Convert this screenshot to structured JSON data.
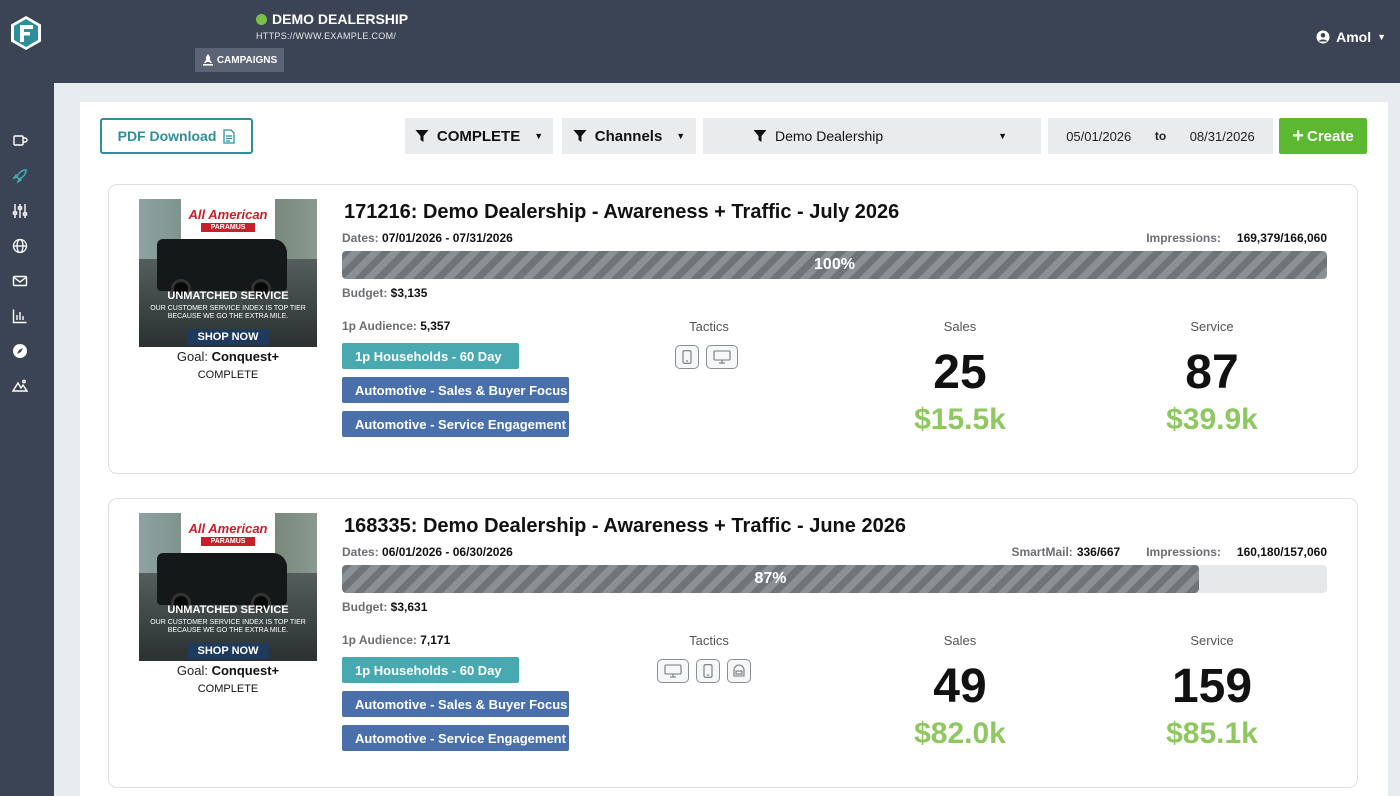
{
  "header": {
    "dealer_name": "DEMO DEALERSHIP",
    "dealer_url": "HTTPS://WWW.EXAMPLE.COM/",
    "campaigns_label": "CAMPAIGNS",
    "user_name": "Amol",
    "status_color": "#7cc04c"
  },
  "sidebar": {
    "items": [
      {
        "icon": "mug-icon"
      },
      {
        "icon": "rocket-icon",
        "active": true
      },
      {
        "icon": "sliders-icon"
      },
      {
        "icon": "globe-icon"
      },
      {
        "icon": "envelope-icon"
      },
      {
        "icon": "bar-chart-icon"
      },
      {
        "icon": "compass-icon"
      },
      {
        "icon": "mountain-icon"
      }
    ]
  },
  "toolbar": {
    "pdf_label": "PDF Download",
    "status_filter": "COMPLETE",
    "channels_filter": "Channels",
    "dealer_filter": "Demo Dealership",
    "date_from": "05/01/2026",
    "date_to_label": "to",
    "date_to": "08/31/2026",
    "create_label": "Create"
  },
  "labels": {
    "dates": "Dates:",
    "impressions": "Impressions:",
    "smartmail": "SmartMail:",
    "budget": "Budget:",
    "audience": "1p Audience:",
    "tactics": "Tactics",
    "sales": "Sales",
    "service": "Service",
    "goal": "Goal:"
  },
  "ad": {
    "brand_line1": "All American",
    "brand_line2": "PARAMUS",
    "headline": "UNMATCHED SERVICE",
    "subline": "OUR CUSTOMER SERVICE INDEX IS TOP TIER BECAUSE WE GO THE EXTRA MILE.",
    "cta": "SHOP NOW"
  },
  "campaigns": [
    {
      "title": "171216: Demo Dealership - Awareness + Traffic - July 2026",
      "dates": "07/01/2026 - 07/31/2026",
      "impressions": "169,379/166,060",
      "smartmail": null,
      "progress_label": "100%",
      "progress": 100,
      "budget": "$3,135",
      "audience": "5,357",
      "goal": "Conquest+",
      "status": "COMPLETE",
      "pills": [
        "1p Households - 60 Day",
        "Automotive - Sales & Buyer Focus",
        "Automotive - Service Engagement"
      ],
      "tactics": [
        "mobile-icon",
        "desktop-icon"
      ],
      "sales_count": "25",
      "sales_value": "$15.5k",
      "service_count": "87",
      "service_value": "$39.9k"
    },
    {
      "title": "168335: Demo Dealership - Awareness + Traffic - June 2026",
      "dates": "06/01/2026 - 06/30/2026",
      "impressions": "160,180/157,060",
      "smartmail": "336/667",
      "progress_label": "87%",
      "progress": 87,
      "budget": "$3,631",
      "audience": "7,171",
      "goal": "Conquest+",
      "status": "COMPLETE",
      "pills": [
        "1p Households - 60 Day",
        "Automotive - Sales & Buyer Focus",
        "Automotive - Service Engagement"
      ],
      "tactics": [
        "desktop-icon",
        "mobile-icon",
        "mailbox-icon"
      ],
      "sales_count": "49",
      "sales_value": "$82.0k",
      "service_count": "159",
      "service_value": "$85.1k"
    }
  ]
}
